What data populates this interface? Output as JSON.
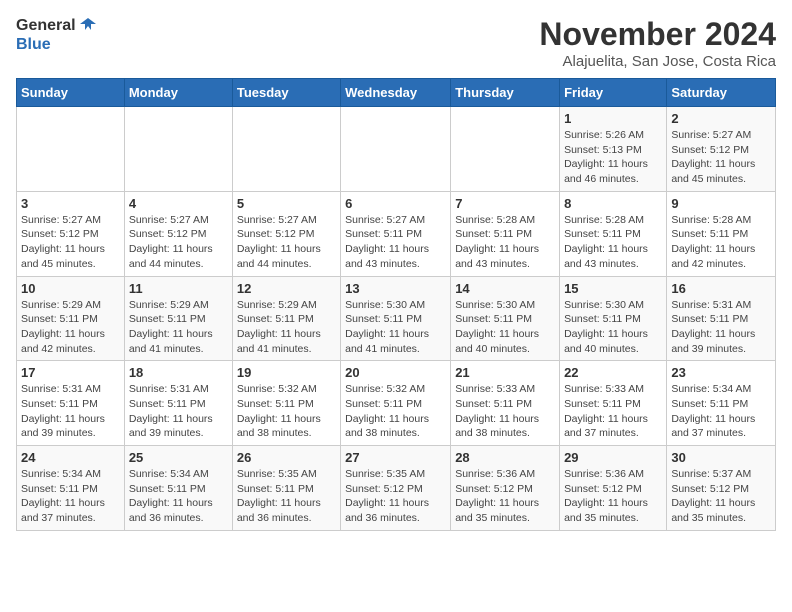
{
  "header": {
    "logo_general": "General",
    "logo_blue": "Blue",
    "month_year": "November 2024",
    "location": "Alajuelita, San Jose, Costa Rica"
  },
  "calendar": {
    "days_of_week": [
      "Sunday",
      "Monday",
      "Tuesday",
      "Wednesday",
      "Thursday",
      "Friday",
      "Saturday"
    ],
    "weeks": [
      [
        {
          "day": "",
          "info": ""
        },
        {
          "day": "",
          "info": ""
        },
        {
          "day": "",
          "info": ""
        },
        {
          "day": "",
          "info": ""
        },
        {
          "day": "",
          "info": ""
        },
        {
          "day": "1",
          "info": "Sunrise: 5:26 AM\nSunset: 5:13 PM\nDaylight: 11 hours and 46 minutes."
        },
        {
          "day": "2",
          "info": "Sunrise: 5:27 AM\nSunset: 5:12 PM\nDaylight: 11 hours and 45 minutes."
        }
      ],
      [
        {
          "day": "3",
          "info": "Sunrise: 5:27 AM\nSunset: 5:12 PM\nDaylight: 11 hours and 45 minutes."
        },
        {
          "day": "4",
          "info": "Sunrise: 5:27 AM\nSunset: 5:12 PM\nDaylight: 11 hours and 44 minutes."
        },
        {
          "day": "5",
          "info": "Sunrise: 5:27 AM\nSunset: 5:12 PM\nDaylight: 11 hours and 44 minutes."
        },
        {
          "day": "6",
          "info": "Sunrise: 5:27 AM\nSunset: 5:11 PM\nDaylight: 11 hours and 43 minutes."
        },
        {
          "day": "7",
          "info": "Sunrise: 5:28 AM\nSunset: 5:11 PM\nDaylight: 11 hours and 43 minutes."
        },
        {
          "day": "8",
          "info": "Sunrise: 5:28 AM\nSunset: 5:11 PM\nDaylight: 11 hours and 43 minutes."
        },
        {
          "day": "9",
          "info": "Sunrise: 5:28 AM\nSunset: 5:11 PM\nDaylight: 11 hours and 42 minutes."
        }
      ],
      [
        {
          "day": "10",
          "info": "Sunrise: 5:29 AM\nSunset: 5:11 PM\nDaylight: 11 hours and 42 minutes."
        },
        {
          "day": "11",
          "info": "Sunrise: 5:29 AM\nSunset: 5:11 PM\nDaylight: 11 hours and 41 minutes."
        },
        {
          "day": "12",
          "info": "Sunrise: 5:29 AM\nSunset: 5:11 PM\nDaylight: 11 hours and 41 minutes."
        },
        {
          "day": "13",
          "info": "Sunrise: 5:30 AM\nSunset: 5:11 PM\nDaylight: 11 hours and 41 minutes."
        },
        {
          "day": "14",
          "info": "Sunrise: 5:30 AM\nSunset: 5:11 PM\nDaylight: 11 hours and 40 minutes."
        },
        {
          "day": "15",
          "info": "Sunrise: 5:30 AM\nSunset: 5:11 PM\nDaylight: 11 hours and 40 minutes."
        },
        {
          "day": "16",
          "info": "Sunrise: 5:31 AM\nSunset: 5:11 PM\nDaylight: 11 hours and 39 minutes."
        }
      ],
      [
        {
          "day": "17",
          "info": "Sunrise: 5:31 AM\nSunset: 5:11 PM\nDaylight: 11 hours and 39 minutes."
        },
        {
          "day": "18",
          "info": "Sunrise: 5:31 AM\nSunset: 5:11 PM\nDaylight: 11 hours and 39 minutes."
        },
        {
          "day": "19",
          "info": "Sunrise: 5:32 AM\nSunset: 5:11 PM\nDaylight: 11 hours and 38 minutes."
        },
        {
          "day": "20",
          "info": "Sunrise: 5:32 AM\nSunset: 5:11 PM\nDaylight: 11 hours and 38 minutes."
        },
        {
          "day": "21",
          "info": "Sunrise: 5:33 AM\nSunset: 5:11 PM\nDaylight: 11 hours and 38 minutes."
        },
        {
          "day": "22",
          "info": "Sunrise: 5:33 AM\nSunset: 5:11 PM\nDaylight: 11 hours and 37 minutes."
        },
        {
          "day": "23",
          "info": "Sunrise: 5:34 AM\nSunset: 5:11 PM\nDaylight: 11 hours and 37 minutes."
        }
      ],
      [
        {
          "day": "24",
          "info": "Sunrise: 5:34 AM\nSunset: 5:11 PM\nDaylight: 11 hours and 37 minutes."
        },
        {
          "day": "25",
          "info": "Sunrise: 5:34 AM\nSunset: 5:11 PM\nDaylight: 11 hours and 36 minutes."
        },
        {
          "day": "26",
          "info": "Sunrise: 5:35 AM\nSunset: 5:11 PM\nDaylight: 11 hours and 36 minutes."
        },
        {
          "day": "27",
          "info": "Sunrise: 5:35 AM\nSunset: 5:12 PM\nDaylight: 11 hours and 36 minutes."
        },
        {
          "day": "28",
          "info": "Sunrise: 5:36 AM\nSunset: 5:12 PM\nDaylight: 11 hours and 35 minutes."
        },
        {
          "day": "29",
          "info": "Sunrise: 5:36 AM\nSunset: 5:12 PM\nDaylight: 11 hours and 35 minutes."
        },
        {
          "day": "30",
          "info": "Sunrise: 5:37 AM\nSunset: 5:12 PM\nDaylight: 11 hours and 35 minutes."
        }
      ]
    ]
  }
}
